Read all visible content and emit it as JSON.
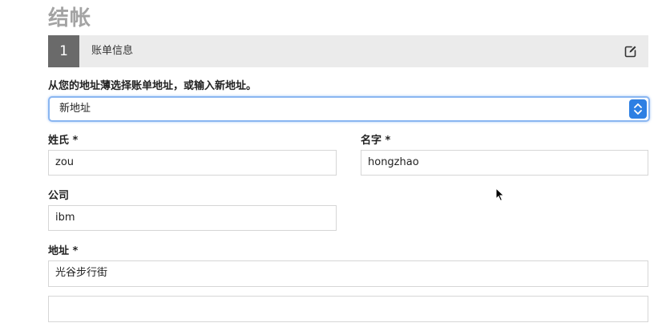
{
  "page": {
    "title": "结帐"
  },
  "step": {
    "number": "1",
    "title": "账单信息",
    "edit_icon": "edit-icon"
  },
  "address_book": {
    "prompt": "从您的地址薄选择账单地址，或输入新地址。",
    "selected": "新地址"
  },
  "form": {
    "last_name": {
      "label": "姓氏 *",
      "value": "zou"
    },
    "first_name": {
      "label": "名字 *",
      "value": "hongzhao"
    },
    "company": {
      "label": "公司",
      "value": "ibm"
    },
    "address": {
      "label": "地址 *",
      "line1": "光谷步行街",
      "line2": ""
    }
  },
  "colors": {
    "accent": "#2d7fe3",
    "step_num_bg": "#6a6a6a",
    "step_bar_bg": "#ebebeb",
    "title": "#a3a3a3"
  }
}
